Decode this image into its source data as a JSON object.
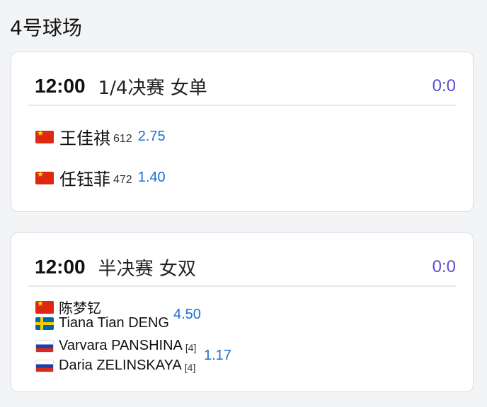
{
  "court": {
    "title": "4号球场"
  },
  "matches": [
    {
      "time": "12:00",
      "round": "1/4决赛 女单",
      "score": "0:0",
      "players": [
        {
          "flag": "china",
          "name": "王佳祺",
          "rank": "612",
          "odds": "2.75"
        },
        {
          "flag": "china",
          "name": "任钰菲",
          "rank": "472",
          "odds": "1.40"
        }
      ]
    },
    {
      "time": "12:00",
      "round": "半决赛 女双",
      "score": "0:0",
      "teams": [
        {
          "odds": "4.50",
          "players": [
            {
              "flag": "china",
              "name": "陈梦钇",
              "seed": ""
            },
            {
              "flag": "sweden",
              "name": "Tiana Tian DENG",
              "seed": ""
            }
          ]
        },
        {
          "odds": "1.17",
          "players": [
            {
              "flag": "russia",
              "name": "Varvara PANSHINA",
              "seed": "[4]"
            },
            {
              "flag": "russia",
              "name": "Daria ZELINSKAYA",
              "seed": "[4]"
            }
          ]
        }
      ]
    }
  ],
  "colors": {
    "score": "#5a4fcf",
    "odds": "#1a6fd6",
    "card_border": "#d9dde3"
  }
}
